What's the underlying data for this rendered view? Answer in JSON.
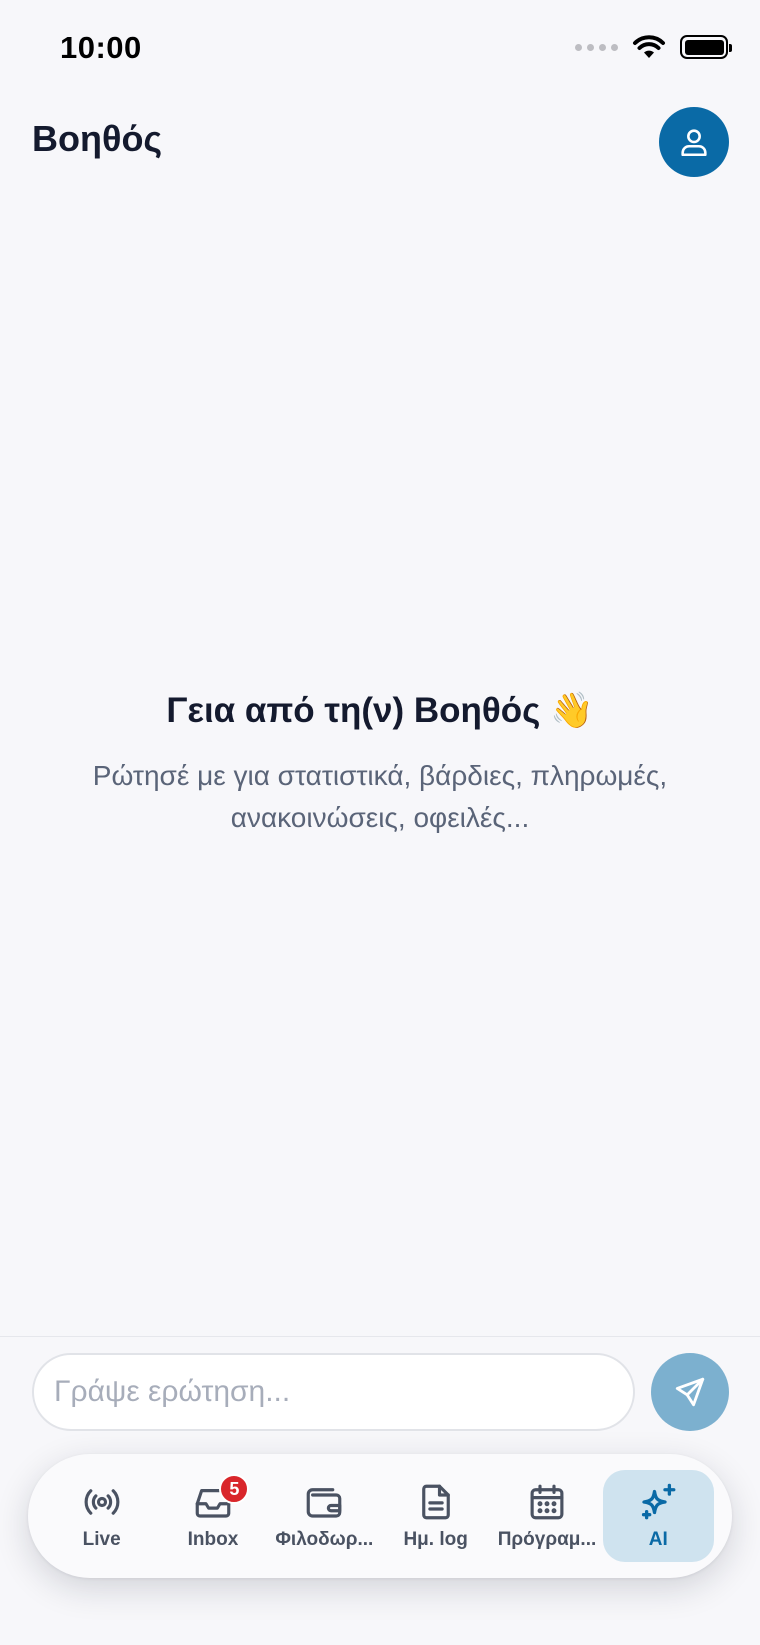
{
  "status_bar": {
    "time": "10:00"
  },
  "header": {
    "title": "Βοηθός"
  },
  "greeting": {
    "title": "Γεια από τη(ν) Βοηθός 👋",
    "subtitle": "Ρώτησέ με για στατιστικά, βάρδιες, πληρωμές, ανακοινώσεις, οφειλές..."
  },
  "composer": {
    "placeholder": "Γράψε ερώτηση..."
  },
  "tabs": [
    {
      "label": "Live",
      "icon": "broadcast-icon"
    },
    {
      "label": "Inbox",
      "icon": "inbox-icon",
      "badge": "5"
    },
    {
      "label": "Φιλοδωρ...",
      "icon": "wallet-icon"
    },
    {
      "label": "Ημ. log",
      "icon": "document-icon"
    },
    {
      "label": "Πρόγραμ...",
      "icon": "calendar-icon"
    },
    {
      "label": "AI",
      "icon": "sparkles-icon",
      "active": true
    }
  ],
  "colors": {
    "accent": "#0a6aa6",
    "badge": "#d9262b",
    "send_disabled": "#7cb0cf"
  }
}
